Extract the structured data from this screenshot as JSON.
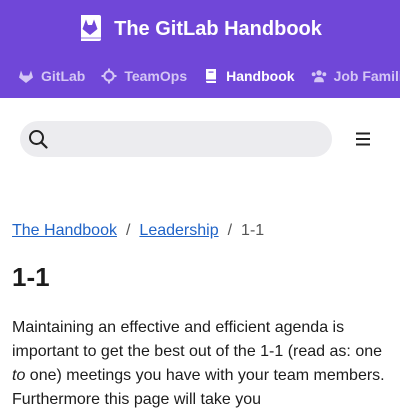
{
  "header": {
    "title": "The GitLab Handbook",
    "logo_icon": "gitlab-handbook-logo-icon",
    "background_color": "#7047d8",
    "nav": [
      {
        "label": "GitLab",
        "icon": "gitlab-tanuki-icon",
        "active": false
      },
      {
        "label": "TeamOps",
        "icon": "teamops-icon",
        "active": false
      },
      {
        "label": "Handbook",
        "icon": "book-icon",
        "active": true
      },
      {
        "label": "Job Families",
        "icon": "people-icon",
        "active": false
      }
    ]
  },
  "search": {
    "placeholder": "",
    "icon": "search-icon"
  },
  "menu": {
    "icon": "hamburger-menu-icon"
  },
  "breadcrumb": {
    "items": [
      "The Handbook",
      "Leadership"
    ],
    "separator": "/",
    "current": "1-1"
  },
  "page": {
    "title": "1-1",
    "intro_before": "Maintaining an effective and efficient agenda is important to get the best out of the 1-1 (read as: one ",
    "intro_em": "to",
    "intro_after": " one) meetings you have with your team members. Furthermore this page will take you"
  },
  "colors": {
    "link": "#1f63c7",
    "accent": "#7047d8",
    "search_bg": "#ececef"
  }
}
